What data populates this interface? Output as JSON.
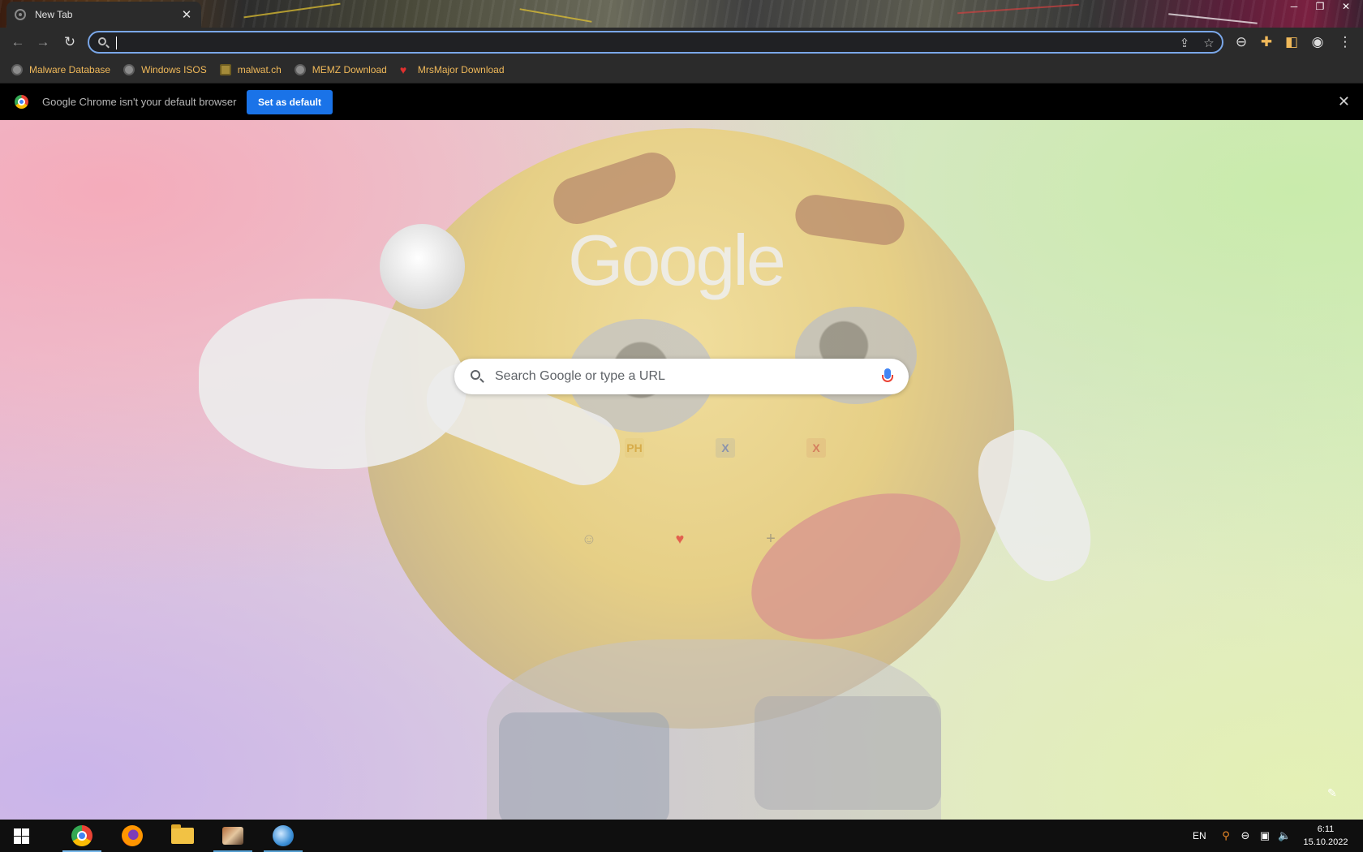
{
  "tab": {
    "title": "New Tab"
  },
  "omnibox": {
    "value": "",
    "placeholder": ""
  },
  "bookmarks": [
    {
      "label": "Malware Database",
      "icon": "globe-icon"
    },
    {
      "label": "Windows ISOS",
      "icon": "globe-icon"
    },
    {
      "label": "malwat.ch",
      "icon": "warning-icon"
    },
    {
      "label": "MEMZ Download",
      "icon": "globe-icon"
    },
    {
      "label": "MrsMajor Download",
      "icon": "heart-icon"
    }
  ],
  "infobar": {
    "message": "Google Chrome isn't your default browser",
    "button_label": "Set as default"
  },
  "ntp": {
    "logo_text": "Google",
    "search_placeholder": "Search Google or type a URL",
    "shortcuts_row1": [
      {
        "icon_text": "",
        "color": "#b0b0b0"
      },
      {
        "icon_text": "PH",
        "color": "#c88a10"
      },
      {
        "icon_text": "X",
        "color": "#3a5cc4"
      },
      {
        "icon_text": "X",
        "color": "#c43a3a"
      }
    ],
    "shortcuts_row2": [
      {
        "icon_text": "☺",
        "color": "#8a8a8a"
      },
      {
        "icon_text": "♥",
        "color": "#e03a3a"
      },
      {
        "icon_text": "+",
        "color": "#777777"
      }
    ]
  },
  "taskbar": {
    "language": "EN",
    "time": "6:11",
    "date": "15.10.2022"
  },
  "colors": {
    "accent": "#1a73e8",
    "bookmark_text": "#f0b95a",
    "omnibox_focus": "#7aa7e8"
  }
}
